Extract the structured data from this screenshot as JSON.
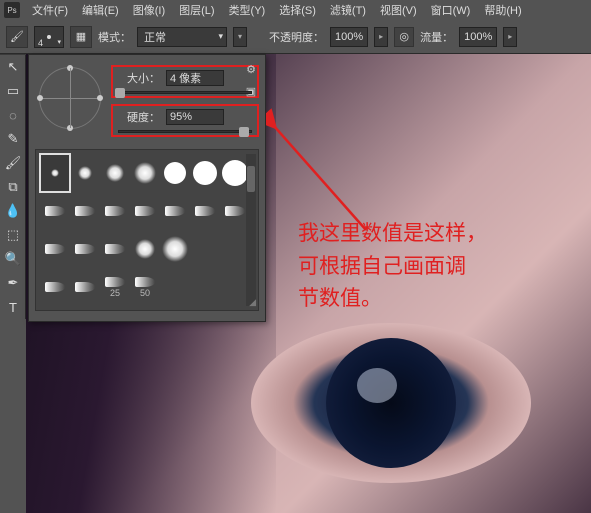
{
  "menubar": {
    "items": [
      "文件(F)",
      "编辑(E)",
      "图像(I)",
      "图层(L)",
      "类型(Y)",
      "选择(S)",
      "滤镜(T)",
      "视图(V)",
      "窗口(W)",
      "帮助(H)"
    ]
  },
  "optionsbar": {
    "brush_size_num": "4",
    "mode_label": "模式：",
    "mode_value": "正常",
    "opacity_label": "不透明度：",
    "opacity_value": "100%",
    "flow_label": "流量：",
    "flow_value": "100%"
  },
  "brush_panel": {
    "size_label": "大小：",
    "size_value": "4 像素",
    "hardness_label": "硬度：",
    "hardness_value": "95%",
    "presets": [
      {
        "kind": "soft",
        "d": 8,
        "sel": true
      },
      {
        "kind": "soft",
        "d": 14
      },
      {
        "kind": "soft",
        "d": 18
      },
      {
        "kind": "soft",
        "d": 22
      },
      {
        "kind": "hard",
        "d": 22
      },
      {
        "kind": "hard",
        "d": 24
      },
      {
        "kind": "hard",
        "d": 26
      },
      {
        "kind": "tip"
      },
      {
        "kind": "tip"
      },
      {
        "kind": "tip"
      },
      {
        "kind": "tip"
      },
      {
        "kind": "tip"
      },
      {
        "kind": "tip"
      },
      {
        "kind": "tip"
      },
      {
        "kind": "tip"
      },
      {
        "kind": "tip"
      },
      {
        "kind": "tip"
      },
      {
        "kind": "soft",
        "d": 20
      },
      {
        "kind": "soft",
        "d": 26
      },
      {
        "kind": "blank"
      },
      {
        "kind": "blank"
      },
      {
        "kind": "tip"
      },
      {
        "kind": "tip"
      },
      {
        "kind": "tip",
        "lbl": "25"
      },
      {
        "kind": "tip",
        "lbl": "50"
      },
      {
        "kind": "blank"
      },
      {
        "kind": "blank"
      },
      {
        "kind": "blank"
      }
    ]
  },
  "annotation": {
    "line1": "我这里数值是这样，",
    "line2": "可根据自己画面调",
    "line3": "节数值。"
  },
  "toolbox_glyphs": [
    "↖",
    "▭",
    "◌",
    "✎",
    "🖌",
    "⧉",
    "◆",
    "⬚",
    "🔍",
    "✒",
    "T"
  ]
}
